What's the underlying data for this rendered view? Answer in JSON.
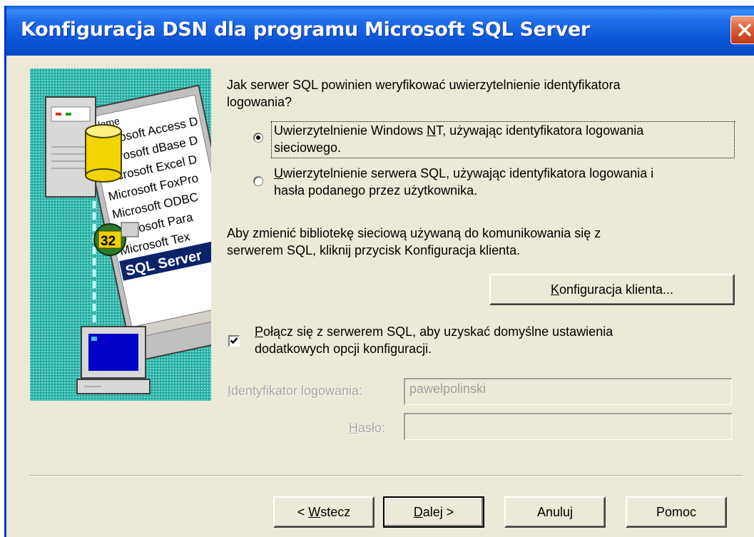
{
  "window": {
    "title": "Konfiguracja DSN dla programu Microsoft SQL Server"
  },
  "side_image": {
    "list_header": "Name",
    "list_items": [
      "Microsoft Access D",
      "Microsoft dBase D",
      "Microsoft Excel D",
      "Microsoft FoxPro",
      "Microsoft ODBC",
      "Microsoft Para",
      "Microsoft Tex",
      "SQL Server"
    ],
    "badge": "32"
  },
  "auth": {
    "question": "Jak serwer SQL powinien weryfikować uwierzytelnienie identyfikatora logowania?",
    "question_line1": "Jak serwer SQL powinien weryfikować uwierzytelnienie identyfikatora",
    "question_line2": "logowania?",
    "option_nt": {
      "label": "Uwierzytelnienie Windows NT, używając identyfikatora logowania sieciowego.",
      "line1_pre": "Uwierzytelnienie Windows ",
      "line1_hot": "N",
      "line1_post": "T, używając identyfikatora logowania",
      "line2": "sieciowego.",
      "selected": true
    },
    "option_sql": {
      "label": "Uwierzytelnienie serwera SQL, używając identyfikatora logowania i hasła podanego przez użytkownika.",
      "line1_hot": "U",
      "line1_post": "wierzytelnienie serwera SQL, używając identyfikatora logowania i",
      "line2": "hasła podanego przez użytkownika.",
      "selected": false
    }
  },
  "library": {
    "text": "Aby zmienić bibliotekę sieciową używaną do komunikowania się z serwerem SQL, kliknij przycisk Konfiguracja klienta.",
    "line1": "Aby zmienić bibliotekę sieciową używaną do komunikowania się z",
    "line2": "serwerem SQL, kliknij przycisk Konfiguracja klienta.",
    "button_hot": "K",
    "button_rest": "onfiguracja klienta..."
  },
  "connect": {
    "label": "Połącz się z serwerem SQL, aby uzyskać domyślne ustawienia dodatkowych opcji konfiguracji.",
    "line1_hot": "P",
    "line1_rest": "ołącz się z serwerem SQL, aby uzyskać domyślne ustawienia",
    "line2": "dodatkowych opcji konfiguracji.",
    "checked": true
  },
  "login": {
    "label_hot": "I",
    "label_rest": "dentyfikator logowania:",
    "value": "pawelpolinski"
  },
  "password": {
    "label_hot": "H",
    "label_rest": "asło:",
    "value": ""
  },
  "buttons": {
    "back_pre": "< ",
    "back_hot": "W",
    "back_rest": "stecz",
    "next_hot": "D",
    "next_rest": "alej >",
    "cancel": "Anuluj",
    "help": "Pomoc"
  },
  "colors": {
    "title_bar": "#0a55d6",
    "dialog_bg": "#ece9d8",
    "close_button": "#e0603c",
    "image_bg": "#2bb5a8"
  },
  "icons": [
    "close-icon",
    "server-icon",
    "database-icon",
    "odbc-32-icon",
    "computer-icon"
  ]
}
